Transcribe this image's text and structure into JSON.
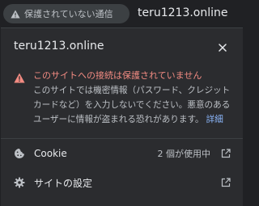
{
  "omnibox": {
    "security_label": "保護されていない通信",
    "url": "teru1213.online",
    "warning_icon": "warning-triangle-icon"
  },
  "bubble": {
    "title": "teru1213.online",
    "close_icon": "close-icon",
    "warning": {
      "title": "このサイトへの接続は保護されていません",
      "body_lines": [
        "このサイトでは機密情報（パスワード、クレジット",
        "カードなど）を入力しないでください。悪意のある",
        "ユーザーに情報が盗まれる恐れがあります。"
      ],
      "details_link": "詳細"
    },
    "cookie_row": {
      "label": "Cookie",
      "value": "2 個が使用中",
      "icon": "cookie-icon",
      "trailing_icon": "open-in-new-icon"
    },
    "site_settings_row": {
      "label": "サイトの設定",
      "icon": "gear-icon",
      "trailing_icon": "open-in-new-icon"
    }
  },
  "colors": {
    "background": "#202124",
    "bubble": "#2b2c2f",
    "warning_red": "#f28b82",
    "link_blue": "#8ab4f8",
    "text": "#e8eaed",
    "secondary_text": "#bdc1c6"
  }
}
